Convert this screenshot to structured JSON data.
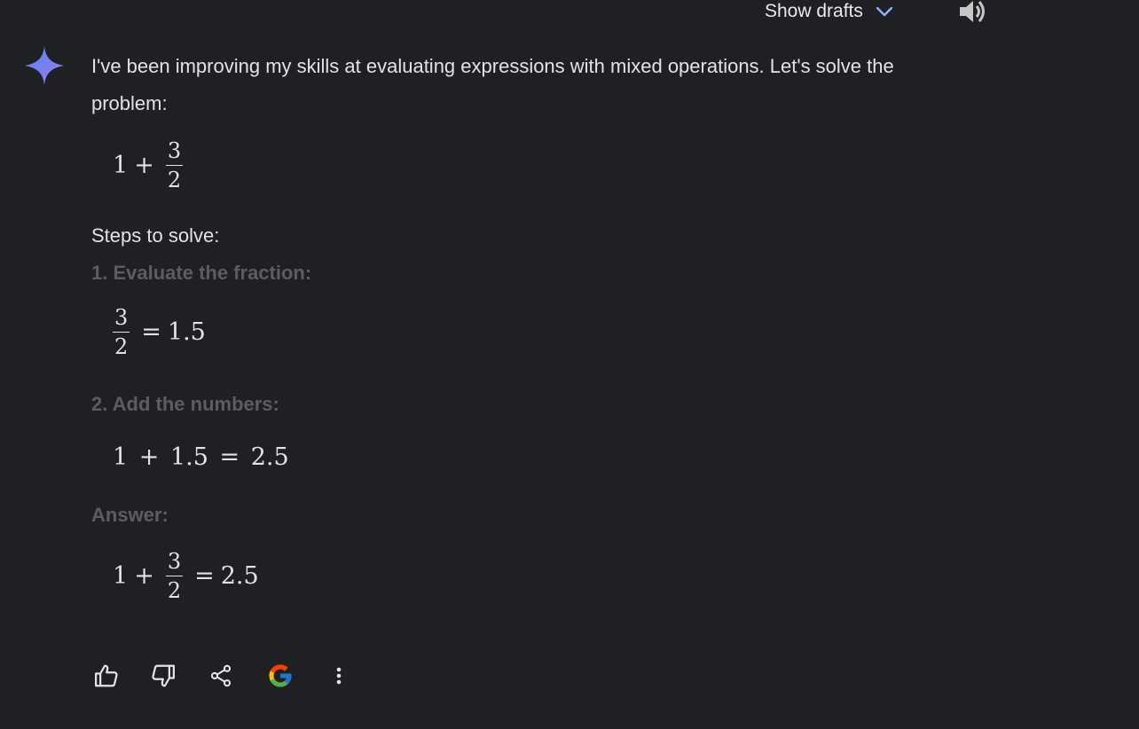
{
  "top_bar": {
    "show_drafts_label": "Show drafts",
    "icons": [
      "chevron-down-icon",
      "speaker-icon"
    ]
  },
  "response": {
    "intro": "I've been improving my skills at evaluating expressions with mixed operations. Let's solve the problem:",
    "problem": {
      "lhs": "1",
      "op": "+",
      "numerator": "3",
      "denominator": "2"
    },
    "steps_heading": "Steps to solve:",
    "step1_heading": "1. Evaluate the fraction:",
    "step1_math": {
      "numerator": "3",
      "denominator": "2",
      "eq": "=",
      "result": "1.5"
    },
    "step2_heading": "2. Add the numbers:",
    "step2_math": {
      "text": "1 + 1.5 = 2.5"
    },
    "answer_heading": "Answer:",
    "answer_math": {
      "lhs": "1",
      "op": "+",
      "numerator": "3",
      "denominator": "2",
      "eq": "=",
      "result": "2.5"
    }
  },
  "actions": {
    "icons": [
      "thumbs-up-icon",
      "thumbs-down-icon",
      "share-icon",
      "google-icon",
      "more-options-icon"
    ]
  },
  "colors": {
    "background": "#1f2023",
    "text": "#e3e3e3",
    "muted": "#5c5d60"
  }
}
